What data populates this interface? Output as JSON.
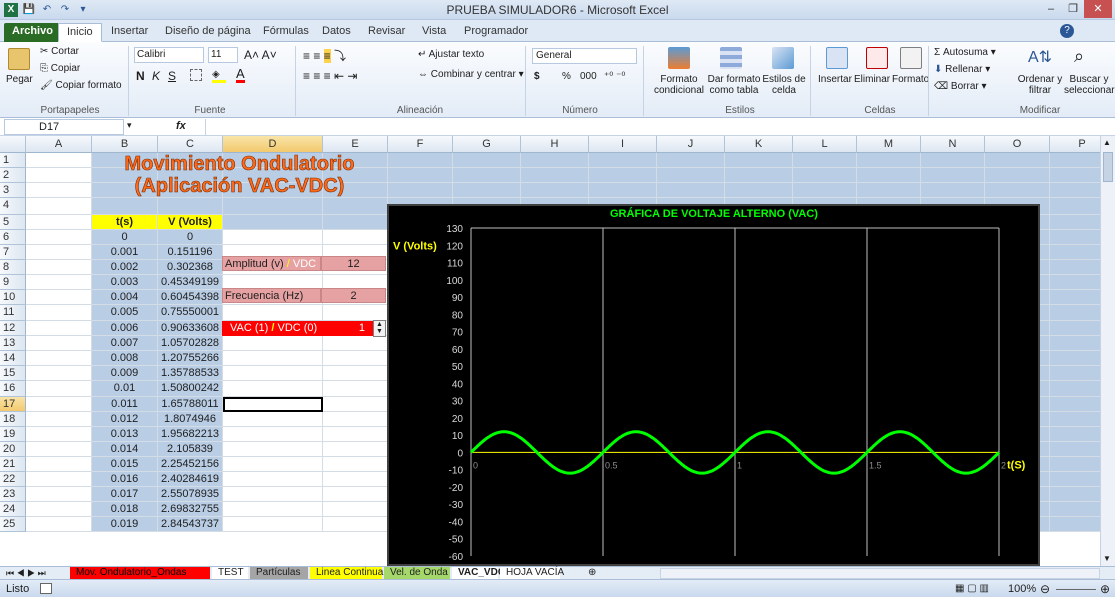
{
  "window": {
    "title": "PRUEBA SIMULADOR6 - Microsoft Excel",
    "file_tab": "Archivo",
    "tabs": [
      "Inicio",
      "Insertar",
      "Diseño de página",
      "Fórmulas",
      "Datos",
      "Revisar",
      "Vista",
      "Programador"
    ]
  },
  "ribbon": {
    "clipboard": {
      "paste": "Pegar",
      "cut": "Cortar",
      "copy": "Copiar",
      "format_painter": "Copiar formato",
      "label": "Portapapeles"
    },
    "font": {
      "name": "Calibri",
      "size": "11",
      "label": "Fuente",
      "bold": "N",
      "italic": "K",
      "underline": "S"
    },
    "alignment": {
      "wrap": "Ajustar texto",
      "merge": "Combinar y centrar",
      "label": "Alineación"
    },
    "number": {
      "format": "General",
      "currency": "$",
      "percent": "%",
      "thousands": "000",
      "label": "Número"
    },
    "styles": {
      "conditional": "Formato condicional",
      "as_table": "Dar formato como tabla",
      "cell_styles": "Estilos de celda",
      "label": "Estilos"
    },
    "cells": {
      "insert": "Insertar",
      "delete": "Eliminar",
      "format": "Formato",
      "label": "Celdas"
    },
    "editing": {
      "autosum": "Autosuma",
      "fill": "Rellenar",
      "clear": "Borrar",
      "sort": "Ordenar y filtrar",
      "find": "Buscar y seleccionar",
      "label": "Modificar"
    }
  },
  "formula_bar": {
    "name_box": "D17",
    "fx": "fx",
    "value": ""
  },
  "columns": [
    "A",
    "B",
    "C",
    "D",
    "E",
    "F",
    "G",
    "H",
    "I",
    "J",
    "K",
    "L",
    "M",
    "N",
    "O",
    "P"
  ],
  "sheet": {
    "title1": "Movimiento Ondulatorio",
    "title2": "(Aplicación VAC-VDC)",
    "header_t": "t(s)",
    "header_v": "V (Volts)",
    "rows": [
      [
        "0",
        "0"
      ],
      [
        "0.001",
        "0.151196"
      ],
      [
        "0.002",
        "0.302368"
      ],
      [
        "0.003",
        "0.45349199"
      ],
      [
        "0.004",
        "0.60454398"
      ],
      [
        "0.005",
        "0.75550001"
      ],
      [
        "0.006",
        "0.90633608"
      ],
      [
        "0.007",
        "1.05702828"
      ],
      [
        "0.008",
        "1.20755266"
      ],
      [
        "0.009",
        "1.35788533"
      ],
      [
        "0.01",
        "1.50800242"
      ],
      [
        "0.011",
        "1.65788011"
      ],
      [
        "0.012",
        "1.8074946"
      ],
      [
        "0.013",
        "1.95682213"
      ],
      [
        "0.014",
        "2.105839"
      ],
      [
        "0.015",
        "2.25452156"
      ],
      [
        "0.016",
        "2.40284619"
      ],
      [
        "0.017",
        "2.55078935"
      ],
      [
        "0.018",
        "2.69832755"
      ],
      [
        "0.019",
        "2.84543737"
      ]
    ],
    "amplitude_label_a": "Amplitud (v) ",
    "amplitude_label_sep": "/",
    "amplitude_label_b": " VDC",
    "amplitude_value": "12",
    "frequency_label": "Frecuencia (Hz)",
    "frequency_value": "2",
    "mode_label_a": "VAC (1) ",
    "mode_label_sep": "/",
    "mode_label_b": " VDC (0)",
    "mode_value": "1"
  },
  "chart_data": {
    "type": "line",
    "title": "GRÁFICA DE VOLTAJE ALTERNO (VAC)",
    "ylabel": "V (Volts)",
    "xlabel": "t(S)",
    "ylim": [
      -60,
      130
    ],
    "yticks": [
      130,
      120,
      110,
      100,
      90,
      80,
      70,
      60,
      50,
      40,
      30,
      20,
      10,
      0,
      -10,
      -20,
      -30,
      -40,
      -50,
      -60
    ],
    "xlim": [
      0,
      2
    ],
    "xticks": [
      "0",
      "0.5",
      "1",
      "1.5",
      "2"
    ],
    "series": [
      {
        "amplitude": 12,
        "frequency_hz": 2
      }
    ],
    "line_color": "#00ff00",
    "background": "#000000"
  },
  "sheet_tabs": [
    {
      "label": "Mov. Ondulatorio_Ondas",
      "color": "#ff0000"
    },
    {
      "label": "TEST",
      "color": "#ffffff"
    },
    {
      "label": "Partículas",
      "color": "#a5a5a5"
    },
    {
      "label": "Linea Continua",
      "color": "#ffff00"
    },
    {
      "label": "Vel. de Onda",
      "color": "#a5d86b"
    },
    {
      "label": "VAC_VDC",
      "color": "#ffffff"
    },
    {
      "label": "HOJA VACÍA",
      "color": "#ffffff"
    }
  ],
  "status": {
    "ready": "Listo",
    "zoom": "100%"
  }
}
